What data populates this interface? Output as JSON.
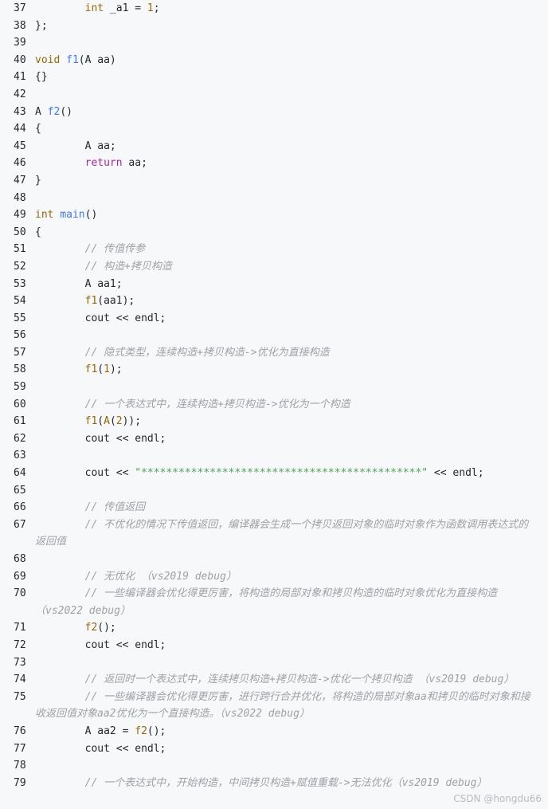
{
  "lines": [
    {
      "num": "37",
      "tokens": [
        {
          "t": "        ",
          "c": ""
        },
        {
          "t": "int",
          "c": "t"
        },
        {
          "t": " _a1 = ",
          "c": ""
        },
        {
          "t": "1",
          "c": "n"
        },
        {
          "t": ";",
          "c": ""
        }
      ]
    },
    {
      "num": "38",
      "tokens": [
        {
          "t": "};",
          "c": ""
        }
      ]
    },
    {
      "num": "39",
      "tokens": []
    },
    {
      "num": "40",
      "tokens": [
        {
          "t": "void",
          "c": "t"
        },
        {
          "t": " ",
          "c": ""
        },
        {
          "t": "f1",
          "c": "f"
        },
        {
          "t": "(A aa)",
          "c": ""
        }
      ]
    },
    {
      "num": "41",
      "tokens": [
        {
          "t": "{}",
          "c": ""
        }
      ]
    },
    {
      "num": "42",
      "tokens": []
    },
    {
      "num": "43",
      "tokens": [
        {
          "t": "A ",
          "c": ""
        },
        {
          "t": "f2",
          "c": "f"
        },
        {
          "t": "()",
          "c": ""
        }
      ]
    },
    {
      "num": "44",
      "tokens": [
        {
          "t": "{",
          "c": ""
        }
      ]
    },
    {
      "num": "45",
      "tokens": [
        {
          "t": "        A aa;",
          "c": ""
        }
      ]
    },
    {
      "num": "46",
      "tokens": [
        {
          "t": "        ",
          "c": ""
        },
        {
          "t": "return",
          "c": "k"
        },
        {
          "t": " aa;",
          "c": ""
        }
      ]
    },
    {
      "num": "47",
      "tokens": [
        {
          "t": "}",
          "c": ""
        }
      ]
    },
    {
      "num": "48",
      "tokens": []
    },
    {
      "num": "49",
      "tokens": [
        {
          "t": "int",
          "c": "t"
        },
        {
          "t": " ",
          "c": ""
        },
        {
          "t": "main",
          "c": "f"
        },
        {
          "t": "()",
          "c": ""
        }
      ]
    },
    {
      "num": "50",
      "tokens": [
        {
          "t": "{",
          "c": ""
        }
      ]
    },
    {
      "num": "51",
      "tokens": [
        {
          "t": "        ",
          "c": ""
        },
        {
          "t": "// 传值传参",
          "c": "c"
        }
      ]
    },
    {
      "num": "52",
      "tokens": [
        {
          "t": "        ",
          "c": ""
        },
        {
          "t": "// 构造+拷贝构造",
          "c": "c"
        }
      ]
    },
    {
      "num": "53",
      "tokens": [
        {
          "t": "        A aa1;",
          "c": ""
        }
      ]
    },
    {
      "num": "54",
      "tokens": [
        {
          "t": "        ",
          "c": ""
        },
        {
          "t": "f1",
          "c": "n"
        },
        {
          "t": "(aa1);",
          "c": ""
        }
      ]
    },
    {
      "num": "55",
      "tokens": [
        {
          "t": "        cout << endl;",
          "c": ""
        }
      ]
    },
    {
      "num": "56",
      "tokens": []
    },
    {
      "num": "57",
      "tokens": [
        {
          "t": "        ",
          "c": ""
        },
        {
          "t": "// 隐式类型，连续构造+拷贝构造->优化为直接构造",
          "c": "c"
        }
      ]
    },
    {
      "num": "58",
      "tokens": [
        {
          "t": "        ",
          "c": ""
        },
        {
          "t": "f1",
          "c": "n"
        },
        {
          "t": "(",
          "c": ""
        },
        {
          "t": "1",
          "c": "n"
        },
        {
          "t": ");",
          "c": ""
        }
      ]
    },
    {
      "num": "59",
      "tokens": []
    },
    {
      "num": "60",
      "tokens": [
        {
          "t": "        ",
          "c": ""
        },
        {
          "t": "// 一个表达式中，连续构造+拷贝构造->优化为一个构造",
          "c": "c"
        }
      ]
    },
    {
      "num": "61",
      "tokens": [
        {
          "t": "        ",
          "c": ""
        },
        {
          "t": "f1",
          "c": "n"
        },
        {
          "t": "(",
          "c": ""
        },
        {
          "t": "A",
          "c": "n"
        },
        {
          "t": "(",
          "c": ""
        },
        {
          "t": "2",
          "c": "n"
        },
        {
          "t": "));",
          "c": ""
        }
      ]
    },
    {
      "num": "62",
      "tokens": [
        {
          "t": "        cout << endl;",
          "c": ""
        }
      ]
    },
    {
      "num": "63",
      "tokens": []
    },
    {
      "num": "64",
      "tokens": [
        {
          "t": "        cout << ",
          "c": ""
        },
        {
          "t": "\"*********************************************\"",
          "c": "s"
        },
        {
          "t": " << endl;",
          "c": ""
        }
      ]
    },
    {
      "num": "65",
      "tokens": []
    },
    {
      "num": "66",
      "tokens": [
        {
          "t": "        ",
          "c": ""
        },
        {
          "t": "// 传值返回",
          "c": "c"
        }
      ]
    },
    {
      "num": "67",
      "tokens": [
        {
          "t": "        ",
          "c": ""
        },
        {
          "t": "// 不优化的情况下传值返回，编译器会生成一个拷贝返回对象的临时对象作为函数调用表达式的返回值",
          "c": "c"
        }
      ]
    },
    {
      "num": "68",
      "tokens": []
    },
    {
      "num": "69",
      "tokens": [
        {
          "t": "        ",
          "c": ""
        },
        {
          "t": "// 无优化 （vs2019 debug）",
          "c": "c"
        }
      ]
    },
    {
      "num": "70",
      "tokens": [
        {
          "t": "        ",
          "c": ""
        },
        {
          "t": "// 一些编译器会优化得更厉害，将构造的局部对象和拷贝构造的临时对象优化为直接构造（vs2022 debug）",
          "c": "c"
        }
      ]
    },
    {
      "num": "71",
      "tokens": [
        {
          "t": "        ",
          "c": ""
        },
        {
          "t": "f2",
          "c": "n"
        },
        {
          "t": "();",
          "c": ""
        }
      ]
    },
    {
      "num": "72",
      "tokens": [
        {
          "t": "        cout << endl;",
          "c": ""
        }
      ]
    },
    {
      "num": "73",
      "tokens": []
    },
    {
      "num": "74",
      "tokens": [
        {
          "t": "        ",
          "c": ""
        },
        {
          "t": "// 返回时一个表达式中，连续拷贝构造+拷贝构造->优化一个拷贝构造 （vs2019 debug）",
          "c": "c"
        }
      ]
    },
    {
      "num": "75",
      "tokens": [
        {
          "t": "        ",
          "c": ""
        },
        {
          "t": "// 一些编译器会优化得更厉害，进行跨行合并优化，将构造的局部对象aa和拷贝的临时对象和接收返回值对象aa2优化为一个直接构造。（vs2022 debug）",
          "c": "c"
        }
      ]
    },
    {
      "num": "76",
      "tokens": [
        {
          "t": "        A aa2 = ",
          "c": ""
        },
        {
          "t": "f2",
          "c": "n"
        },
        {
          "t": "();",
          "c": ""
        }
      ]
    },
    {
      "num": "77",
      "tokens": [
        {
          "t": "        cout << endl;",
          "c": ""
        }
      ]
    },
    {
      "num": "78",
      "tokens": []
    },
    {
      "num": "79",
      "tokens": [
        {
          "t": "        ",
          "c": ""
        },
        {
          "t": "// 一个表达式中，开始构造，中间拷贝构造+赋值重载->无法优化（vs2019 debug）",
          "c": "c"
        }
      ]
    }
  ],
  "watermark": "CSDN @hongdu66"
}
